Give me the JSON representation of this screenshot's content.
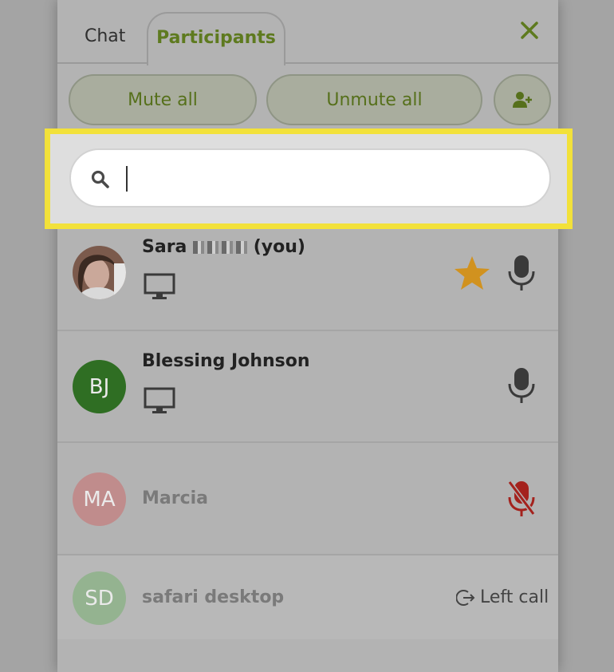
{
  "tabs": {
    "chat": "Chat",
    "participants": "Participants"
  },
  "actions": {
    "mute_all": "Mute all",
    "unmute_all": "Unmute all"
  },
  "search": {
    "value": "",
    "placeholder": ""
  },
  "participants": [
    {
      "name_prefix": "Sara",
      "name_suffix": "(you)",
      "initials": "",
      "status": "speaking",
      "mic": "on",
      "host": true,
      "device": "desktop"
    },
    {
      "name": "Blessing Johnson",
      "initials": "BJ",
      "mic": "on",
      "device": "desktop"
    },
    {
      "name": "Marcia",
      "initials": "MA",
      "mic": "muted"
    },
    {
      "name": "safari desktop",
      "initials": "SD",
      "status_text": "Left call"
    }
  ],
  "colors": {
    "accent": "#5e7a1f",
    "highlight": "#f2e13a",
    "bj_avatar": "#2f6e23",
    "ma_avatar": "#c08c8c",
    "sd_avatar": "#94b390",
    "star": "#d1921f",
    "muted_mic": "#a4221d"
  },
  "icons": [
    "close-icon",
    "add-person-icon",
    "search-icon",
    "monitor-icon",
    "star-icon",
    "microphone-icon",
    "microphone-muted-icon",
    "left-call-icon"
  ]
}
